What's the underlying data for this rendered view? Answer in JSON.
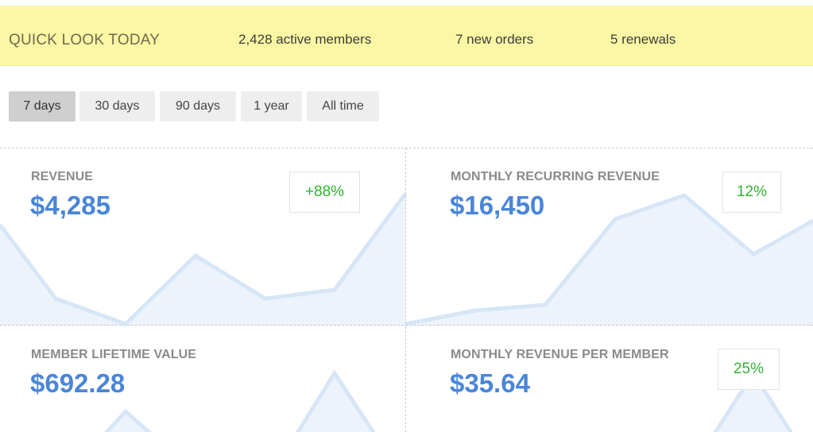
{
  "quick_look": {
    "title": "QUICK LOOK TODAY",
    "active_members": "2,428 active members",
    "new_orders": "7 new orders",
    "renewals": "5 renewals"
  },
  "ranges": [
    "7 days",
    "30 days",
    "90 days",
    "1 year",
    "All time"
  ],
  "active_range": "7 days",
  "metrics": [
    {
      "label": "REVENUE",
      "value": "$4,285",
      "change": "+88%"
    },
    {
      "label": "MONTHLY RECURRING REVENUE",
      "value": "$16,450",
      "change": "12%"
    },
    {
      "label": "MEMBER LIFETIME VALUE",
      "value": "$692.28",
      "change": ""
    },
    {
      "label": "MONTHLY REVENUE PER MEMBER",
      "value": "$35.64",
      "change": "25%"
    }
  ],
  "colors": {
    "banner_bg": "#fbf7a4",
    "value_blue": "#4a86d8",
    "change_green": "#2fb52f",
    "sparkline_fill": "#edf3fb",
    "sparkline_line": "#d6e6f6"
  }
}
